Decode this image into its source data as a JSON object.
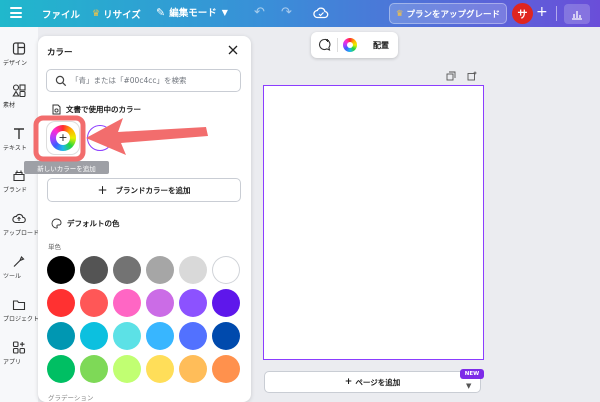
{
  "topbar": {
    "file": "ファイル",
    "resize": "リサイズ",
    "edit_mode": "編集モード",
    "upgrade": "プランをアップグレード",
    "avatar_initial": "サ"
  },
  "sidebar": {
    "items": [
      {
        "label": "デザイン",
        "icon": "design-icon"
      },
      {
        "label": "素材",
        "icon": "elements-icon"
      },
      {
        "label": "テキスト",
        "icon": "text-icon"
      },
      {
        "label": "ブランド",
        "icon": "brand-icon"
      },
      {
        "label": "アップロード",
        "icon": "upload-icon"
      },
      {
        "label": "ツール",
        "icon": "tools-icon"
      },
      {
        "label": "プロジェクト",
        "icon": "projects-icon"
      },
      {
        "label": "アプリ",
        "icon": "apps-icon"
      }
    ]
  },
  "panel": {
    "title": "カラー",
    "search_placeholder": "「青」または「#00c4cc」を検索",
    "doc_colors_title": "文書で使用中のカラー",
    "add_color_tooltip": "新しいカラーを追加",
    "brand_button": "ブランドカラーを追加",
    "default_colors_title": "デフォルトの色",
    "mono_label": "単色",
    "bottom_label": "グラデーション",
    "used_colors": [
      "#ffffff"
    ],
    "swatches": [
      [
        "#000000",
        "#545454",
        "#737373",
        "#a6a6a6",
        "#d9d9d9",
        "#ffffff"
      ],
      [
        "#ff3131",
        "#ff5757",
        "#ff66c4",
        "#cb6ce6",
        "#8c52ff",
        "#5e17eb"
      ],
      [
        "#0097b2",
        "#0cc0df",
        "#5ce1e6",
        "#38b6ff",
        "#5271ff",
        "#004aad"
      ],
      [
        "#00bf63",
        "#7ed957",
        "#c1ff72",
        "#ffde59",
        "#ffbd59",
        "#ff914d"
      ]
    ]
  },
  "editor": {
    "ctx_layout": "配置",
    "add_page": "ページを追加",
    "new_badge": "NEW"
  },
  "colors": {
    "accent": "#8b3dff",
    "annotation_arrow": "#f26d6d"
  }
}
